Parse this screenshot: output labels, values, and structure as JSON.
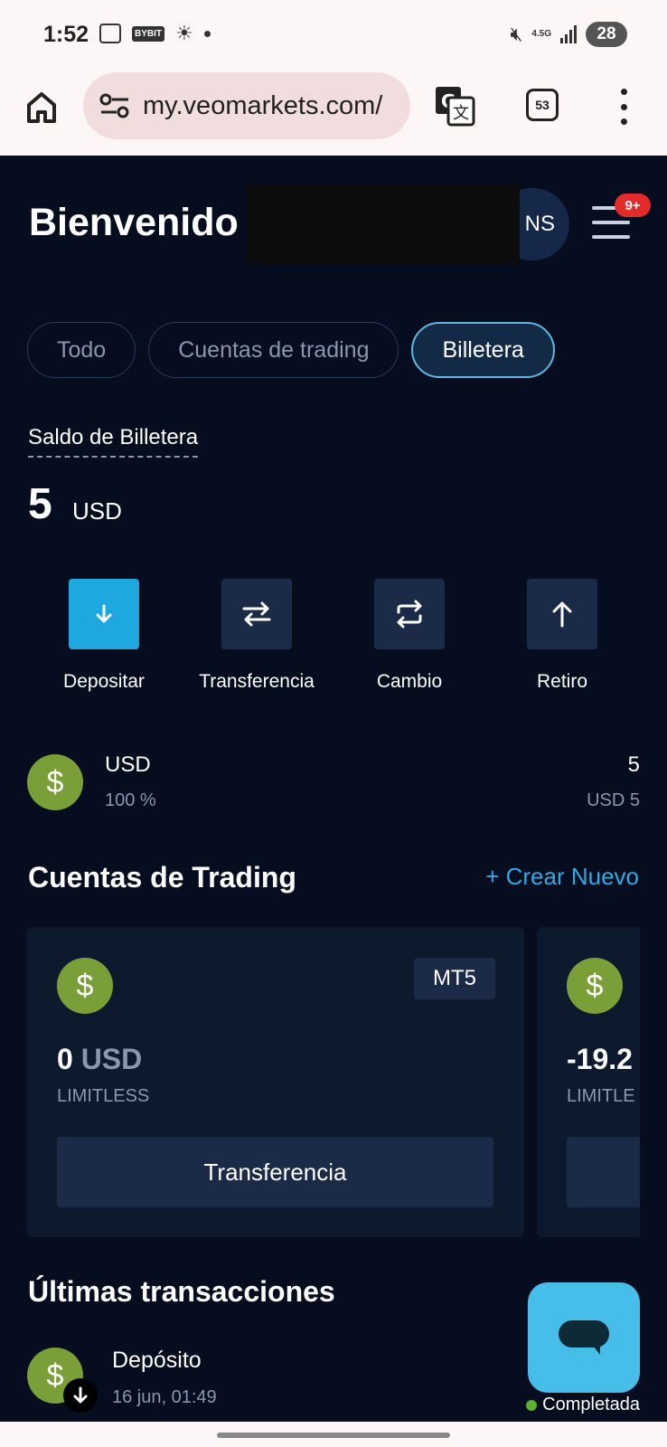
{
  "status_bar": {
    "time": "1:52",
    "bybit_label": "BYBIT",
    "network": "4.5G",
    "battery": "28"
  },
  "browser": {
    "url": "my.veomarkets.com/",
    "tab_count": "53"
  },
  "header": {
    "welcome": "Bienvenido",
    "avatar_initials": "NS",
    "notifications": "9+"
  },
  "filters": [
    {
      "label": "Todo"
    },
    {
      "label": "Cuentas de trading"
    },
    {
      "label": "Billetera"
    }
  ],
  "balance": {
    "label": "Saldo de Billetera",
    "value": "5",
    "currency": "USD"
  },
  "actions": [
    {
      "label": "Depositar",
      "icon": "arrow-down-icon"
    },
    {
      "label": "Transferencia",
      "icon": "swap-icon"
    },
    {
      "label": "Cambio",
      "icon": "exchange-icon"
    },
    {
      "label": "Retiro",
      "icon": "arrow-up-icon"
    }
  ],
  "currency_row": {
    "symbol": "$",
    "name": "USD",
    "percent": "100 %",
    "amount": "5",
    "sub": "USD 5"
  },
  "trading": {
    "title": "Cuentas de Trading",
    "create_label": "+ Crear Nuevo",
    "cards": [
      {
        "symbol": "$",
        "platform": "MT5",
        "balance": "0",
        "currency": "USD",
        "type": "LIMITLESS",
        "button": "Transferencia"
      },
      {
        "symbol": "$",
        "balance_partial": "-19.2",
        "type_partial": "LIMITLE"
      }
    ]
  },
  "transactions": {
    "title": "Últimas transacciones",
    "items": [
      {
        "symbol": "$",
        "title": "Depósito",
        "date": "16 jun, 01:49",
        "status": "Completada"
      }
    ]
  },
  "colors": {
    "background": "#050d1f",
    "accent": "#1ea8e0",
    "coin": "#7a9f38",
    "success": "#5bb12f",
    "badge": "#e22b2b"
  }
}
